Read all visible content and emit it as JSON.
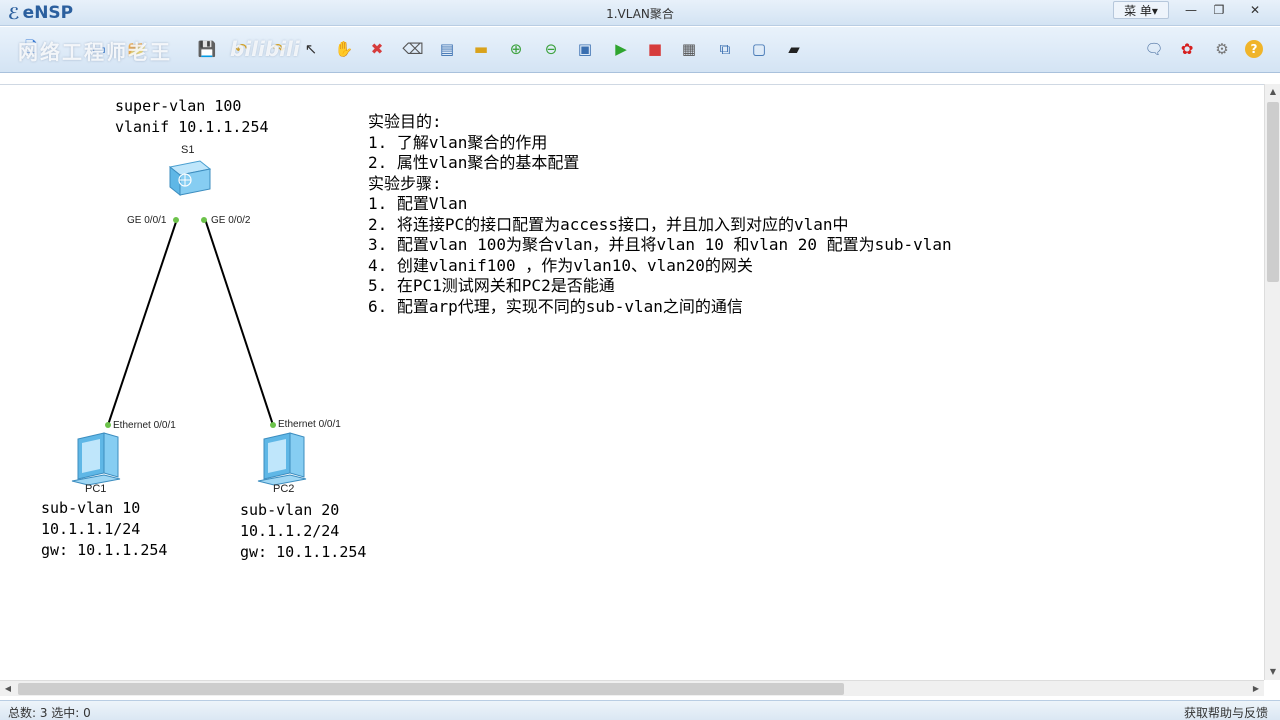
{
  "app": {
    "logo_glyph": "ℰ",
    "name": "eNSP",
    "window_title": "1.VLAN聚合",
    "menu_label": "菜 单▾"
  },
  "window_controls": {
    "minimize": "—",
    "restore": "❐",
    "close": "✕"
  },
  "watermark": {
    "text": "网络工程师老王",
    "text2": "bilibili"
  },
  "toolbar": {
    "icons": [
      {
        "name": "new-topology-icon",
        "glyph": "🗋",
        "color": "#3a7bd5"
      },
      {
        "name": "new-icon",
        "glyph": "▭",
        "color": "#2d6fc4"
      },
      {
        "name": "open-icon",
        "glyph": "📂",
        "color": "#d9a21b"
      },
      {
        "name": "save-icon",
        "glyph": "💾",
        "color": "#3a6fb0"
      },
      {
        "name": "undo-icon",
        "glyph": "↶",
        "color": "#d9a21b"
      },
      {
        "name": "redo-icon",
        "glyph": "↷",
        "color": "#d9a21b"
      },
      {
        "name": "select-icon",
        "glyph": "↖",
        "color": "#333333"
      },
      {
        "name": "hand-icon",
        "glyph": "✋",
        "color": "#d98a1b"
      },
      {
        "name": "delete-icon",
        "glyph": "✖",
        "color": "#d63c3c"
      },
      {
        "name": "delete-link-icon",
        "glyph": "⌫",
        "color": "#555555"
      },
      {
        "name": "text-icon",
        "glyph": "▤",
        "color": "#3a6fb0"
      },
      {
        "name": "palette-icon",
        "glyph": "▬",
        "color": "#d9a21b"
      },
      {
        "name": "zoom-in-icon",
        "glyph": "⊕",
        "color": "#3aa13a"
      },
      {
        "name": "zoom-out-icon",
        "glyph": "⊖",
        "color": "#3aa13a"
      },
      {
        "name": "fit-icon",
        "glyph": "▣",
        "color": "#3a6fb0"
      },
      {
        "name": "start-icon",
        "glyph": "▶",
        "color": "#2fa52f"
      },
      {
        "name": "stop-icon",
        "glyph": "■",
        "color": "#d63c3c"
      },
      {
        "name": "capture-icon",
        "glyph": "▦",
        "color": "#555555"
      },
      {
        "name": "topology-icon",
        "glyph": "⧉",
        "color": "#3a6fb0"
      },
      {
        "name": "panel-icon",
        "glyph": "▢",
        "color": "#3a6fb0"
      },
      {
        "name": "cli-icon",
        "glyph": "▰",
        "color": "#222222"
      }
    ],
    "right_icons": [
      {
        "name": "message-icon",
        "glyph": "🗨",
        "color": "#4a6fa0"
      },
      {
        "name": "huawei-icon",
        "glyph": "✿",
        "color": "#d61f1f"
      },
      {
        "name": "settings-icon",
        "glyph": "⚙",
        "color": "#777777"
      },
      {
        "name": "help-icon",
        "glyph": "?",
        "color": "#e0a020"
      }
    ]
  },
  "topology": {
    "s1_label_1": "super-vlan 100",
    "s1_label_2": "vlanif 10.1.1.254",
    "switch_name": "S1",
    "port_s1_left": "GE 0/0/1",
    "port_s1_right": "GE 0/0/2",
    "port_pc1": "Ethernet 0/0/1",
    "port_pc2": "Ethernet 0/0/1",
    "pc1_name": "PC1",
    "pc2_name": "PC2",
    "pc1_labels": [
      "sub-vlan 10",
      "10.1.1.1/24",
      "gw: 10.1.1.254"
    ],
    "pc2_labels": [
      "sub-vlan 20",
      "10.1.1.2/24",
      "gw: 10.1.1.254"
    ],
    "colors": {
      "link": "#000000",
      "port_dot": "#6cc24a",
      "device": "#4fb6e8"
    }
  },
  "notes": [
    "实验目的:",
    "1. 了解vlan聚合的作用",
    "2. 属性vlan聚合的基本配置",
    "实验步骤:",
    "1. 配置Vlan",
    "2. 将连接PC的接口配置为access接口，并且加入到对应的vlan中",
    "3. 配置vlan 100为聚合vlan，并且将vlan 10 和vlan 20 配置为sub-vlan",
    "4. 创建vlanif100 ，作为vlan10、vlan20的网关",
    "5. 在PC1测试网关和PC2是否能通",
    "6. 配置arp代理，实现不同的sub-vlan之间的通信"
  ],
  "status": {
    "left": "总数: 3  选中: 0",
    "right": "获取帮助与反馈"
  }
}
